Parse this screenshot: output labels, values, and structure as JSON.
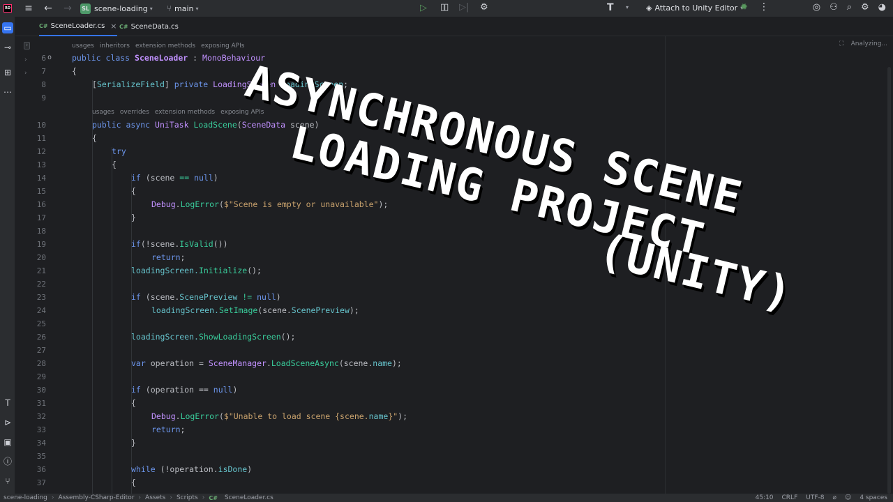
{
  "titlebar": {
    "logo": "RD",
    "project_badge": "SL",
    "project_name": "scene-loading",
    "branch": "main",
    "attach_label": "Attach to Unity Editor",
    "analyzing": "Analyzing..."
  },
  "tabs": [
    {
      "badge": "C#",
      "label": "SceneLoader.cs"
    },
    {
      "badge": "C#",
      "label": "SceneData.cs"
    }
  ],
  "hints": {
    "class": [
      "usages",
      "inheritors",
      "extension methods",
      "exposing APIs"
    ],
    "method": [
      "usages",
      "overrides",
      "extension methods",
      "exposing APIs"
    ]
  },
  "line_numbers": [
    "6",
    "7",
    "8",
    "9",
    "10",
    "11",
    "12",
    "13",
    "14",
    "15",
    "16",
    "17",
    "18",
    "19",
    "20",
    "21",
    "22",
    "23",
    "24",
    "25",
    "26",
    "27",
    "28",
    "29",
    "30",
    "31",
    "32",
    "33",
    "34",
    "35",
    "36",
    "37"
  ],
  "gutter_marker": "o",
  "code": {
    "l6": [
      "public",
      "class",
      "SceneLoader",
      ":",
      "MonoBehaviour"
    ],
    "l7": "{",
    "l8": [
      "[",
      "SerializeField",
      "]",
      "private",
      "LoadingScreen",
      "loadingScreen",
      ";"
    ],
    "l10": [
      "public",
      "async",
      "UniTask",
      "LoadScene",
      "(",
      "SceneData",
      "scene",
      ")"
    ],
    "l11": "{",
    "l12": "try",
    "l13": "{",
    "l14": [
      "if",
      "(scene",
      "==",
      "null",
      ")"
    ],
    "l15": "{",
    "l16": [
      "Debug",
      ".",
      "LogError",
      "(",
      "$\"Scene is empty or unavailable\"",
      ");"
    ],
    "l17": "}",
    "l19": [
      "if",
      "(!scene.",
      "IsValid",
      "())"
    ],
    "l20": [
      "return",
      ";"
    ],
    "l21": [
      "loadingScreen.",
      "Initialize",
      "();"
    ],
    "l23": [
      "if",
      "(scene.",
      "ScenePreview",
      "!=",
      "null",
      ")"
    ],
    "l24": [
      "loadingScreen.",
      "SetImage",
      "(scene.",
      "ScenePreview",
      ");"
    ],
    "l26": [
      "loadingScreen.",
      "ShowLoadingScreen",
      "();"
    ],
    "l28": [
      "var",
      "operation",
      "=",
      "SceneManager",
      ".",
      "LoadSceneAsync",
      "(scene.",
      "name",
      ");"
    ],
    "l30": [
      "if",
      "(operation",
      "==",
      "null",
      ")"
    ],
    "l31": "{",
    "l32": [
      "Debug",
      ".",
      "LogError",
      "(",
      "$\"Unable to load scene {scene.",
      "name",
      "}\"",
      ");"
    ],
    "l33": [
      "return",
      ";"
    ],
    "l34": "}",
    "l36": [
      "while",
      "(!operation.",
      "isDone",
      ")"
    ],
    "l37": "{"
  },
  "statusbar": {
    "crumbs": [
      "scene-loading",
      "Assembly-CSharp-Editor",
      "Assets",
      "Scripts",
      "SceneLoader.cs"
    ],
    "crumb_badge": "C#",
    "position": "45:10",
    "line_ending": "CRLF",
    "encoding": "UTF-8",
    "indent": "4 spaces"
  },
  "overlay": {
    "line1": "ASYNCHRONOUS SCENE",
    "line2": "LOADING PROJECT",
    "line3": "(UNITY)"
  },
  "colors": {
    "editor_bg": "#1e1f22",
    "panel_bg": "#2b2d30",
    "keyword": "#6c95eb",
    "type": "#c191ff",
    "method": "#39cc9b",
    "string": "#c9a26d",
    "accent": "#3574f0"
  },
  "icons": {
    "menu": "hamburger-menu-icon",
    "run": "play-icon",
    "debug": "pause-icon",
    "stop": "stop-icon",
    "profiler": "bug-icon"
  }
}
